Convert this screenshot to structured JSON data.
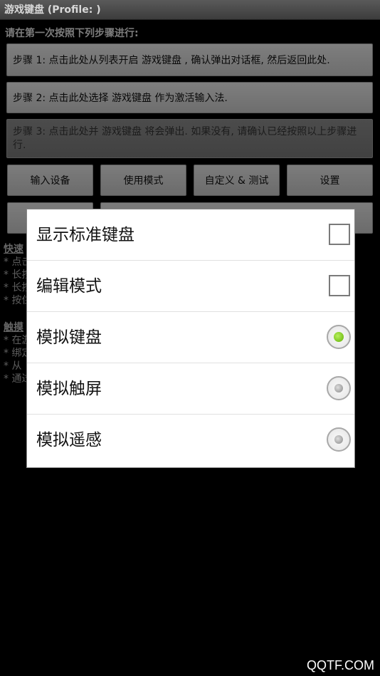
{
  "app": {
    "title": "游戏键盘 (Profile: )"
  },
  "instruction": "请在第一次按照下列步骤进行:",
  "steps": [
    "步骤 1: 点击此处从列表开启 游戏键盘 , 确认弹出对话框, 然后返回此处.",
    "步骤 2: 点击此处选择 游戏键盘 作为激活输入法.",
    "步骤 3: 点击此处并 游戏键盘 将会弹出. 如果没有, 请确认已经按照以上步骤进行."
  ],
  "buttons": [
    "输入设备",
    "使用模式",
    "自定义 & 测试",
    "设置"
  ],
  "background": {
    "quick_heading": "快速",
    "quick_lines": [
      "* 点击",
      "* 长按",
      "* 长按",
      "* 按住"
    ],
    "touch_heading": "触摸",
    "touch_lines": [
      "* 在游",
      "* 绑定",
      "* 从",
      "* 通过"
    ]
  },
  "dialog": {
    "items": [
      {
        "label": "显示标准键盘",
        "control": "checkbox",
        "checked": false
      },
      {
        "label": "编辑模式",
        "control": "checkbox",
        "checked": false
      },
      {
        "label": "模拟键盘",
        "control": "radio",
        "checked": true
      },
      {
        "label": "模拟触屏",
        "control": "radio",
        "checked": false
      },
      {
        "label": "模拟遥感",
        "control": "radio",
        "checked": false
      }
    ]
  },
  "watermark": "QQTF.COM",
  "colors": {
    "radio_selected": "#7ac943",
    "titlebar": "#4a4a4a"
  }
}
